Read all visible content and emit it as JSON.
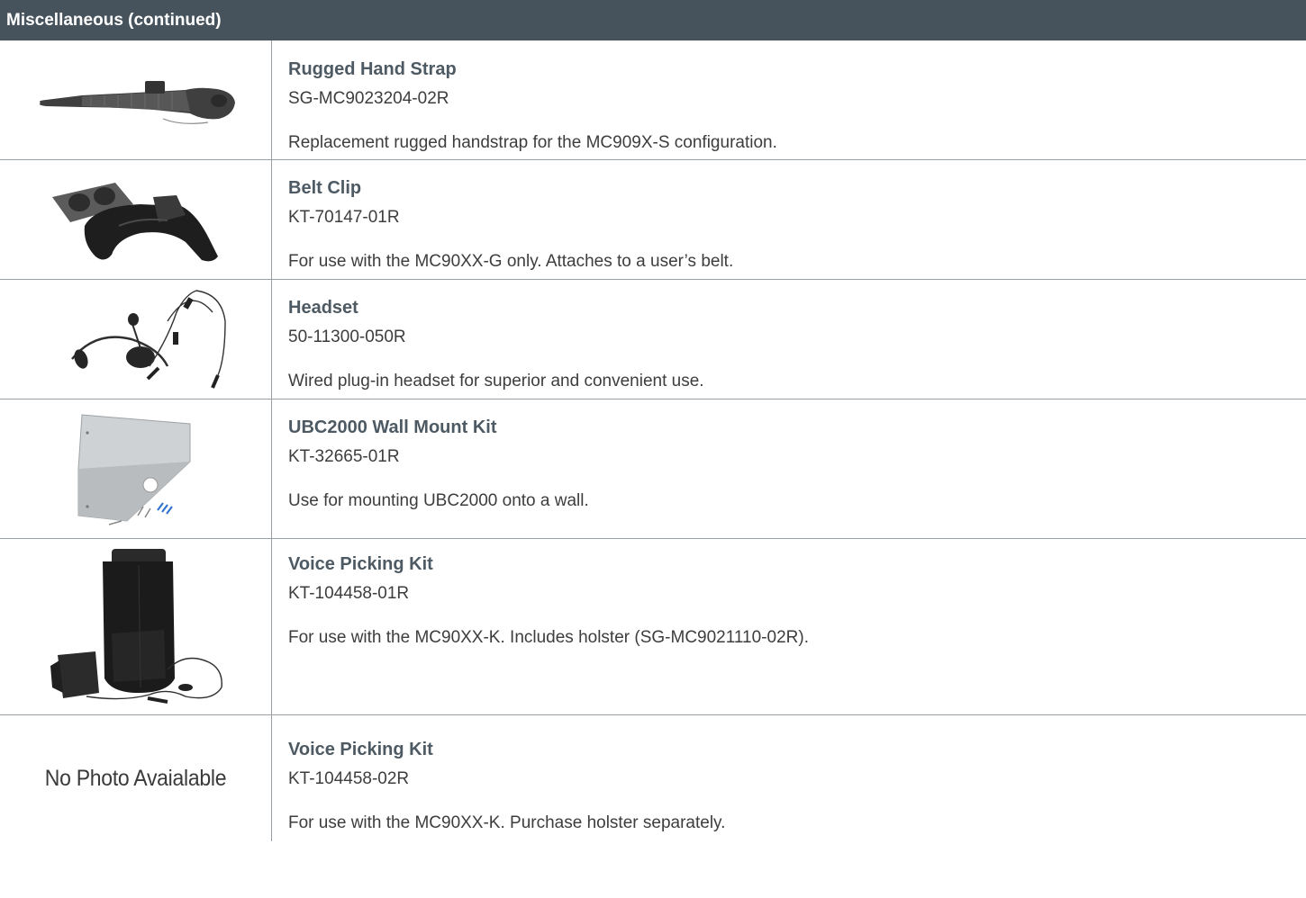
{
  "section": {
    "title": "Miscellaneous (continued)"
  },
  "items": [
    {
      "title": "Rugged Hand Strap",
      "code": "SG-MC9023204-02R",
      "description": "Replacement rugged handstrap for the MC909X-S configuration.",
      "image": "hand-strap"
    },
    {
      "title": "Belt Clip",
      "code": "KT-70147-01R",
      "description": "For use with the MC90XX-G only. Attaches to a user’s belt.",
      "image": "belt-clip"
    },
    {
      "title": "Headset",
      "code": "50-11300-050R",
      "description": "Wired plug-in headset for superior and convenient use.",
      "image": "headset"
    },
    {
      "title": "UBC2000 Wall Mount Kit",
      "code": "KT-32665-01R",
      "description": "Use for mounting UBC2000 onto a wall.",
      "image": "wall-mount-kit"
    },
    {
      "title": "Voice Picking Kit",
      "code": "KT-104458-01R",
      "description": "For use with the MC90XX-K. Includes holster (SG-MC9021110-02R).",
      "image": "voice-picking-kit"
    },
    {
      "title": "Voice Picking Kit",
      "code": "KT-104458-02R",
      "description": "For use with the MC90XX-K. Purchase holster separately.",
      "image": "none",
      "no_photo_text": "No Photo Avaialable"
    }
  ]
}
